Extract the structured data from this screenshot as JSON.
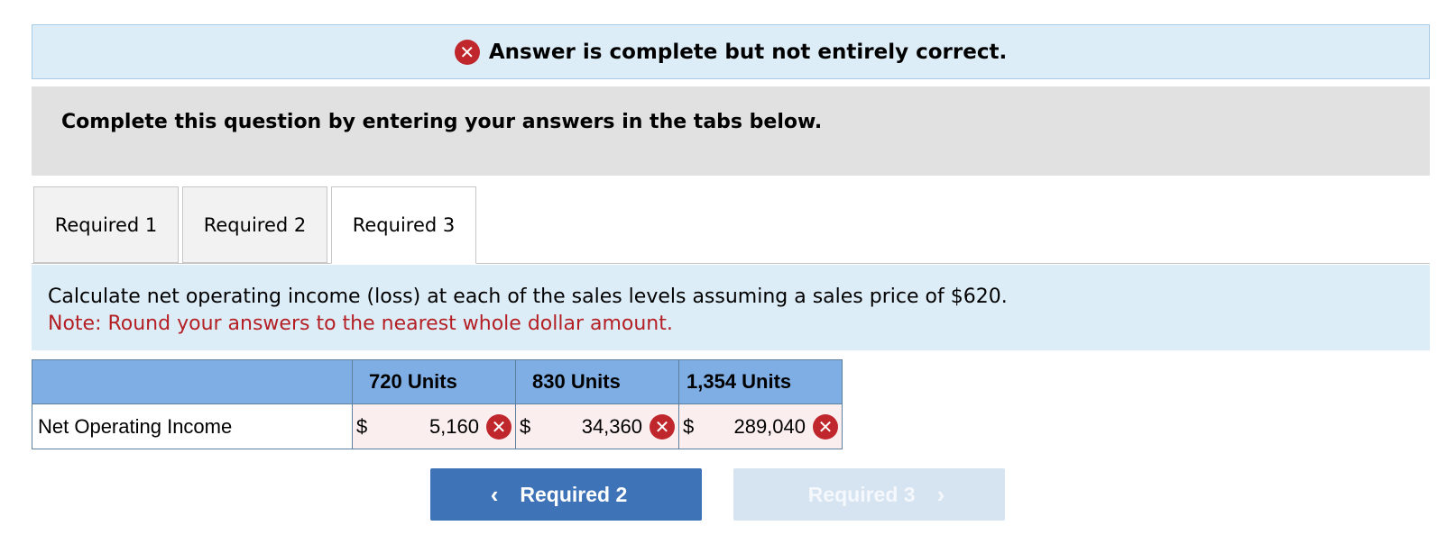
{
  "banner": {
    "icon": "error-x-icon",
    "text": "Answer is complete but not entirely correct."
  },
  "instructions": {
    "text": "Complete this question by entering your answers in the tabs below."
  },
  "tabs": [
    {
      "label": "Required 1"
    },
    {
      "label": "Required 2"
    },
    {
      "label": "Required 3",
      "active": true
    }
  ],
  "question": {
    "text": "Calculate net operating income (loss) at each of the sales levels assuming a sales price of $620.",
    "note": "Note: Round your answers to the nearest whole dollar amount."
  },
  "table": {
    "headers": [
      "",
      "720 Units",
      "830 Units",
      "1,354 Units"
    ],
    "row_label": "Net Operating Income",
    "currency": "$",
    "values": [
      "5,160",
      "34,360",
      "289,040"
    ],
    "status": "incorrect"
  },
  "navigation": {
    "prev_label": "Required 2",
    "next_label": "Required 3",
    "next_enabled": false
  },
  "colors": {
    "banner_bg": "#ddedf8",
    "error_red": "#c0272d",
    "note_red": "#b41f24",
    "header_blue": "#7eaee3",
    "prev_button": "#3f73b8",
    "next_button_disabled": "#d6e3f0"
  }
}
